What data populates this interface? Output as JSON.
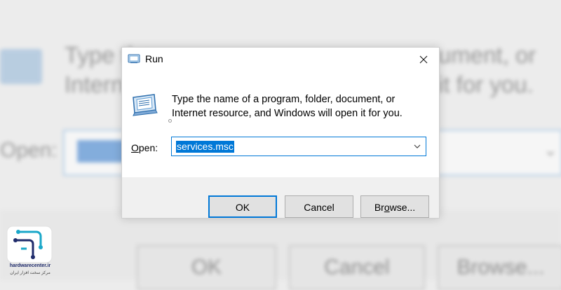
{
  "window": {
    "title": "Run",
    "icon": "run-icon",
    "close_icon": "close-icon"
  },
  "description": "Type the name of a program, folder, document, or Internet resource, and Windows will open it for you.",
  "open_field": {
    "label": "Open:",
    "label_underline_char": "O",
    "value": "services.msc",
    "dropdown_icon": "chevron-down-icon"
  },
  "buttons": {
    "ok": "OK",
    "cancel": "Cancel",
    "browse": "Browse..."
  },
  "background_blur": {
    "line1": "Type the",
    "line2": "Interne",
    "line1_right": "ument, or",
    "line2_right": "it for you.",
    "open_label": "Open:",
    "ok": "OK",
    "cancel": "Cancel",
    "browse": "Browse..."
  },
  "watermark": {
    "site": "hardwarecenter.ir",
    "tagline": "مرکز سخت افزار ایران"
  },
  "colors": {
    "accent": "#0078d7",
    "button_face": "#e1e1e1",
    "footer": "#f0f0f0"
  }
}
